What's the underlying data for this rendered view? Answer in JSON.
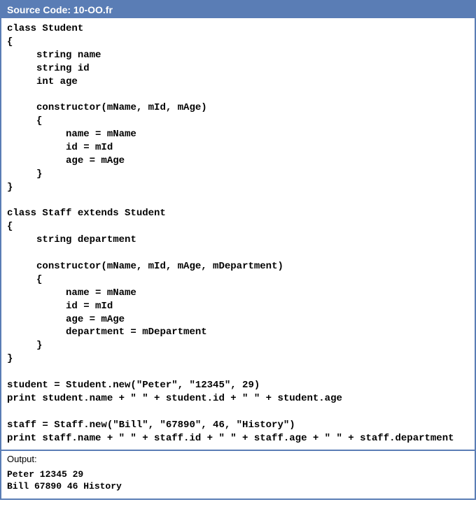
{
  "header": {
    "title": "Source Code: 10-OO.fr"
  },
  "source": {
    "code": "class Student\n{\n     string name\n     string id\n     int age\n\n     constructor(mName, mId, mAge)\n     {\n          name = mName\n          id = mId\n          age = mAge\n     }\n}\n\nclass Staff extends Student\n{\n     string department\n\n     constructor(mName, mId, mAge, mDepartment)\n     {\n          name = mName\n          id = mId\n          age = mAge\n          department = mDepartment\n     }\n}\n\nstudent = Student.new(\"Peter\", \"12345\", 29)\nprint student.name + \" \" + student.id + \" \" + student.age\n\nstaff = Staff.new(\"Bill\", \"67890\", 46, \"History\")\nprint staff.name + \" \" + staff.id + \" \" + staff.age + \" \" + staff.department"
  },
  "output": {
    "label": "Output:",
    "text": "Peter 12345 29\nBill 67890 46 History"
  }
}
